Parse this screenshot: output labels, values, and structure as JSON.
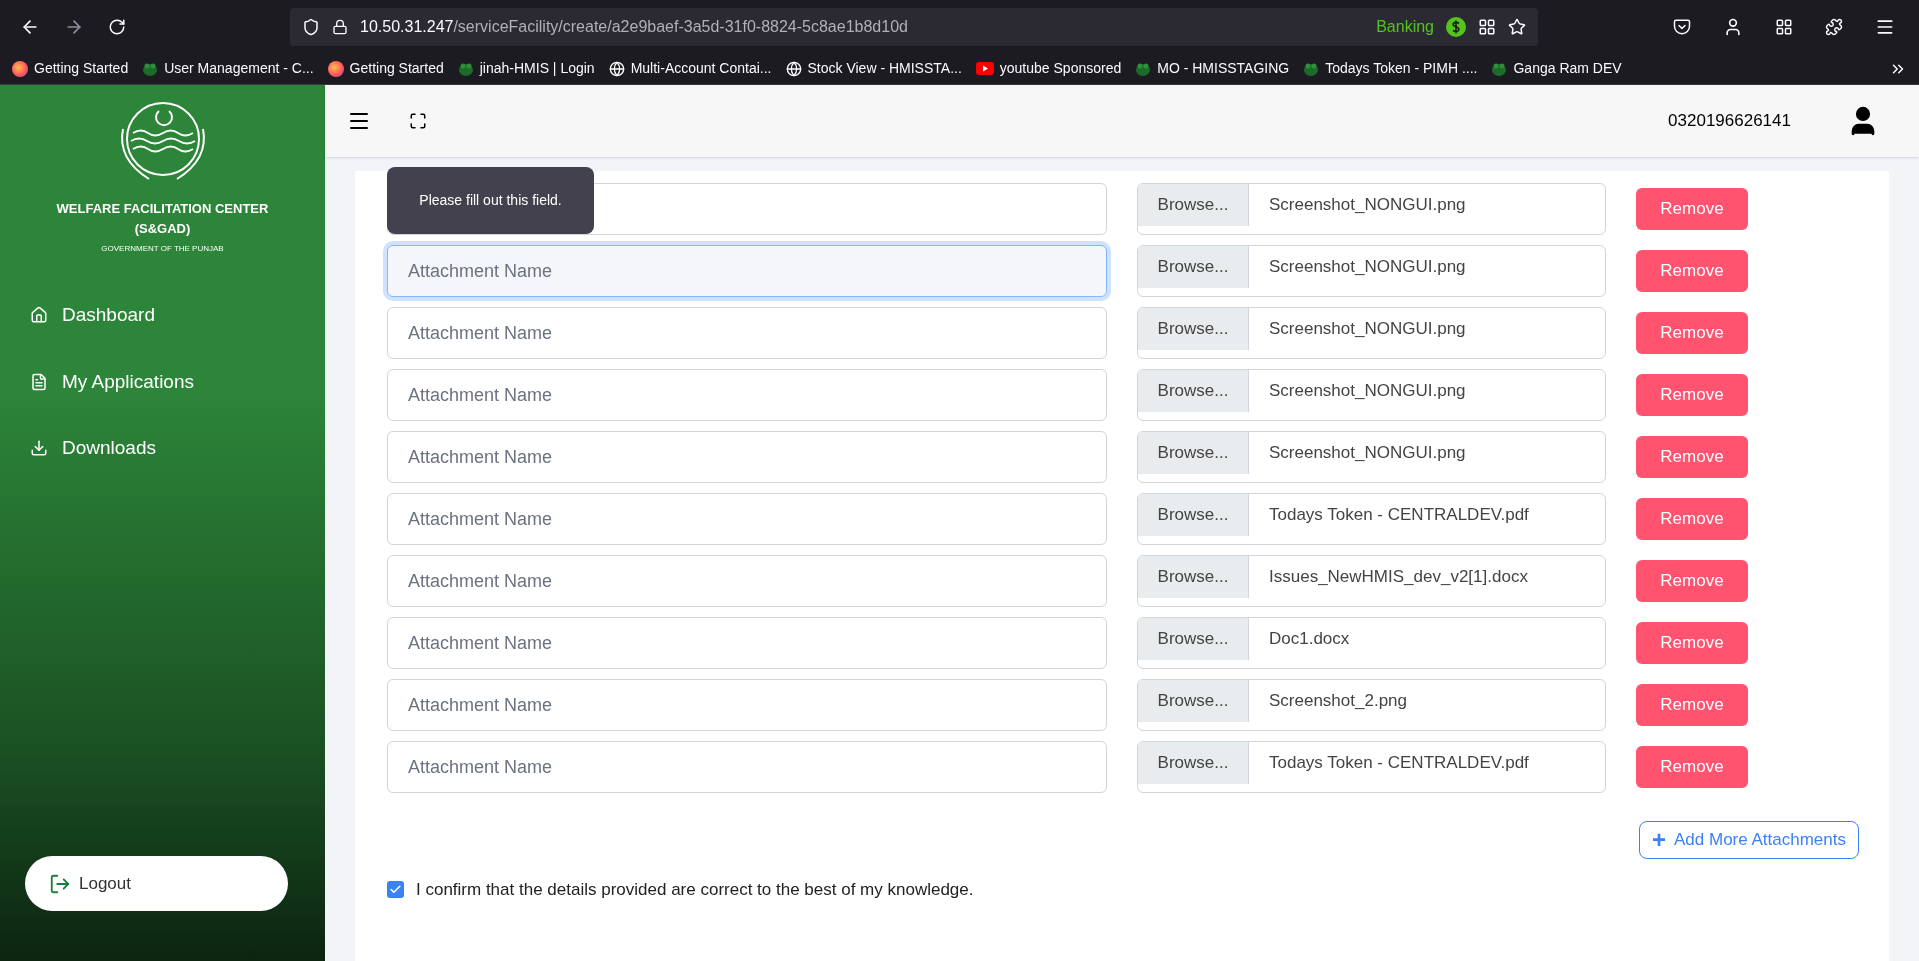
{
  "browser": {
    "url_host": "10.50.31.247",
    "url_path": "/serviceFacility/create/a2e9baef-3a5d-31f0-8824-5c8ae1b8d10d",
    "badge": "Banking",
    "bookmarks": [
      {
        "label": "Getting Started",
        "kind": "firefox"
      },
      {
        "label": "User Management - C...",
        "kind": "frog"
      },
      {
        "label": "Getting Started",
        "kind": "firefox"
      },
      {
        "label": "jinah-HMIS | Login",
        "kind": "frog"
      },
      {
        "label": "Multi-Account Contai...",
        "kind": "globe"
      },
      {
        "label": "Stock View - HMISSTA...",
        "kind": "globe"
      },
      {
        "label": "youtube Sponsored",
        "kind": "youtube"
      },
      {
        "label": "MO - HMISSTAGING",
        "kind": "frog"
      },
      {
        "label": "Todays Token - PIMH ....",
        "kind": "frog"
      },
      {
        "label": "Ganga Ram DEV",
        "kind": "frog"
      }
    ]
  },
  "sidebar": {
    "title": "WELFARE FACILITATION CENTER (S&GAD)",
    "subtitle": "GOVERNMENT OF THE PUNJAB",
    "items": [
      {
        "label": "Dashboard",
        "kind": "home"
      },
      {
        "label": "My Applications",
        "kind": "document"
      },
      {
        "label": "Downloads",
        "kind": "download"
      }
    ],
    "logout": "Logout"
  },
  "header": {
    "user": "0320196626141"
  },
  "tooltip": "Please fill out this field.",
  "attachments": [
    {
      "focused": false,
      "browse": "Browse...",
      "file": "Screenshot_NONGUI.png",
      "remove": "Remove"
    },
    {
      "placeholder": "Attachment Name",
      "focused": true,
      "browse": "Browse...",
      "file": "Screenshot_NONGUI.png",
      "remove": "Remove"
    },
    {
      "placeholder": "Attachment Name",
      "focused": false,
      "browse": "Browse...",
      "file": "Screenshot_NONGUI.png",
      "remove": "Remove"
    },
    {
      "placeholder": "Attachment Name",
      "focused": false,
      "browse": "Browse...",
      "file": "Screenshot_NONGUI.png",
      "remove": "Remove"
    },
    {
      "placeholder": "Attachment Name",
      "focused": false,
      "browse": "Browse...",
      "file": "Screenshot_NONGUI.png",
      "remove": "Remove"
    },
    {
      "placeholder": "Attachment Name",
      "focused": false,
      "browse": "Browse...",
      "file": "Todays Token - CENTRALDEV.pdf",
      "remove": "Remove"
    },
    {
      "placeholder": "Attachment Name",
      "focused": false,
      "browse": "Browse...",
      "file": "Issues_NewHMIS_dev_v2[1].docx",
      "remove": "Remove"
    },
    {
      "placeholder": "Attachment Name",
      "focused": false,
      "browse": "Browse...",
      "file": "Doc1.docx",
      "remove": "Remove"
    },
    {
      "placeholder": "Attachment Name",
      "focused": false,
      "browse": "Browse...",
      "file": "Screenshot_2.png",
      "remove": "Remove"
    },
    {
      "placeholder": "Attachment Name",
      "focused": false,
      "browse": "Browse...",
      "file": "Todays Token - CENTRALDEV.pdf",
      "remove": "Remove"
    }
  ],
  "add_button": {
    "icon": "+",
    "label": "Add More Attachments"
  },
  "confirm": {
    "text": "I confirm that the details provided are correct to the best of my knowledge.",
    "checked": true
  }
}
